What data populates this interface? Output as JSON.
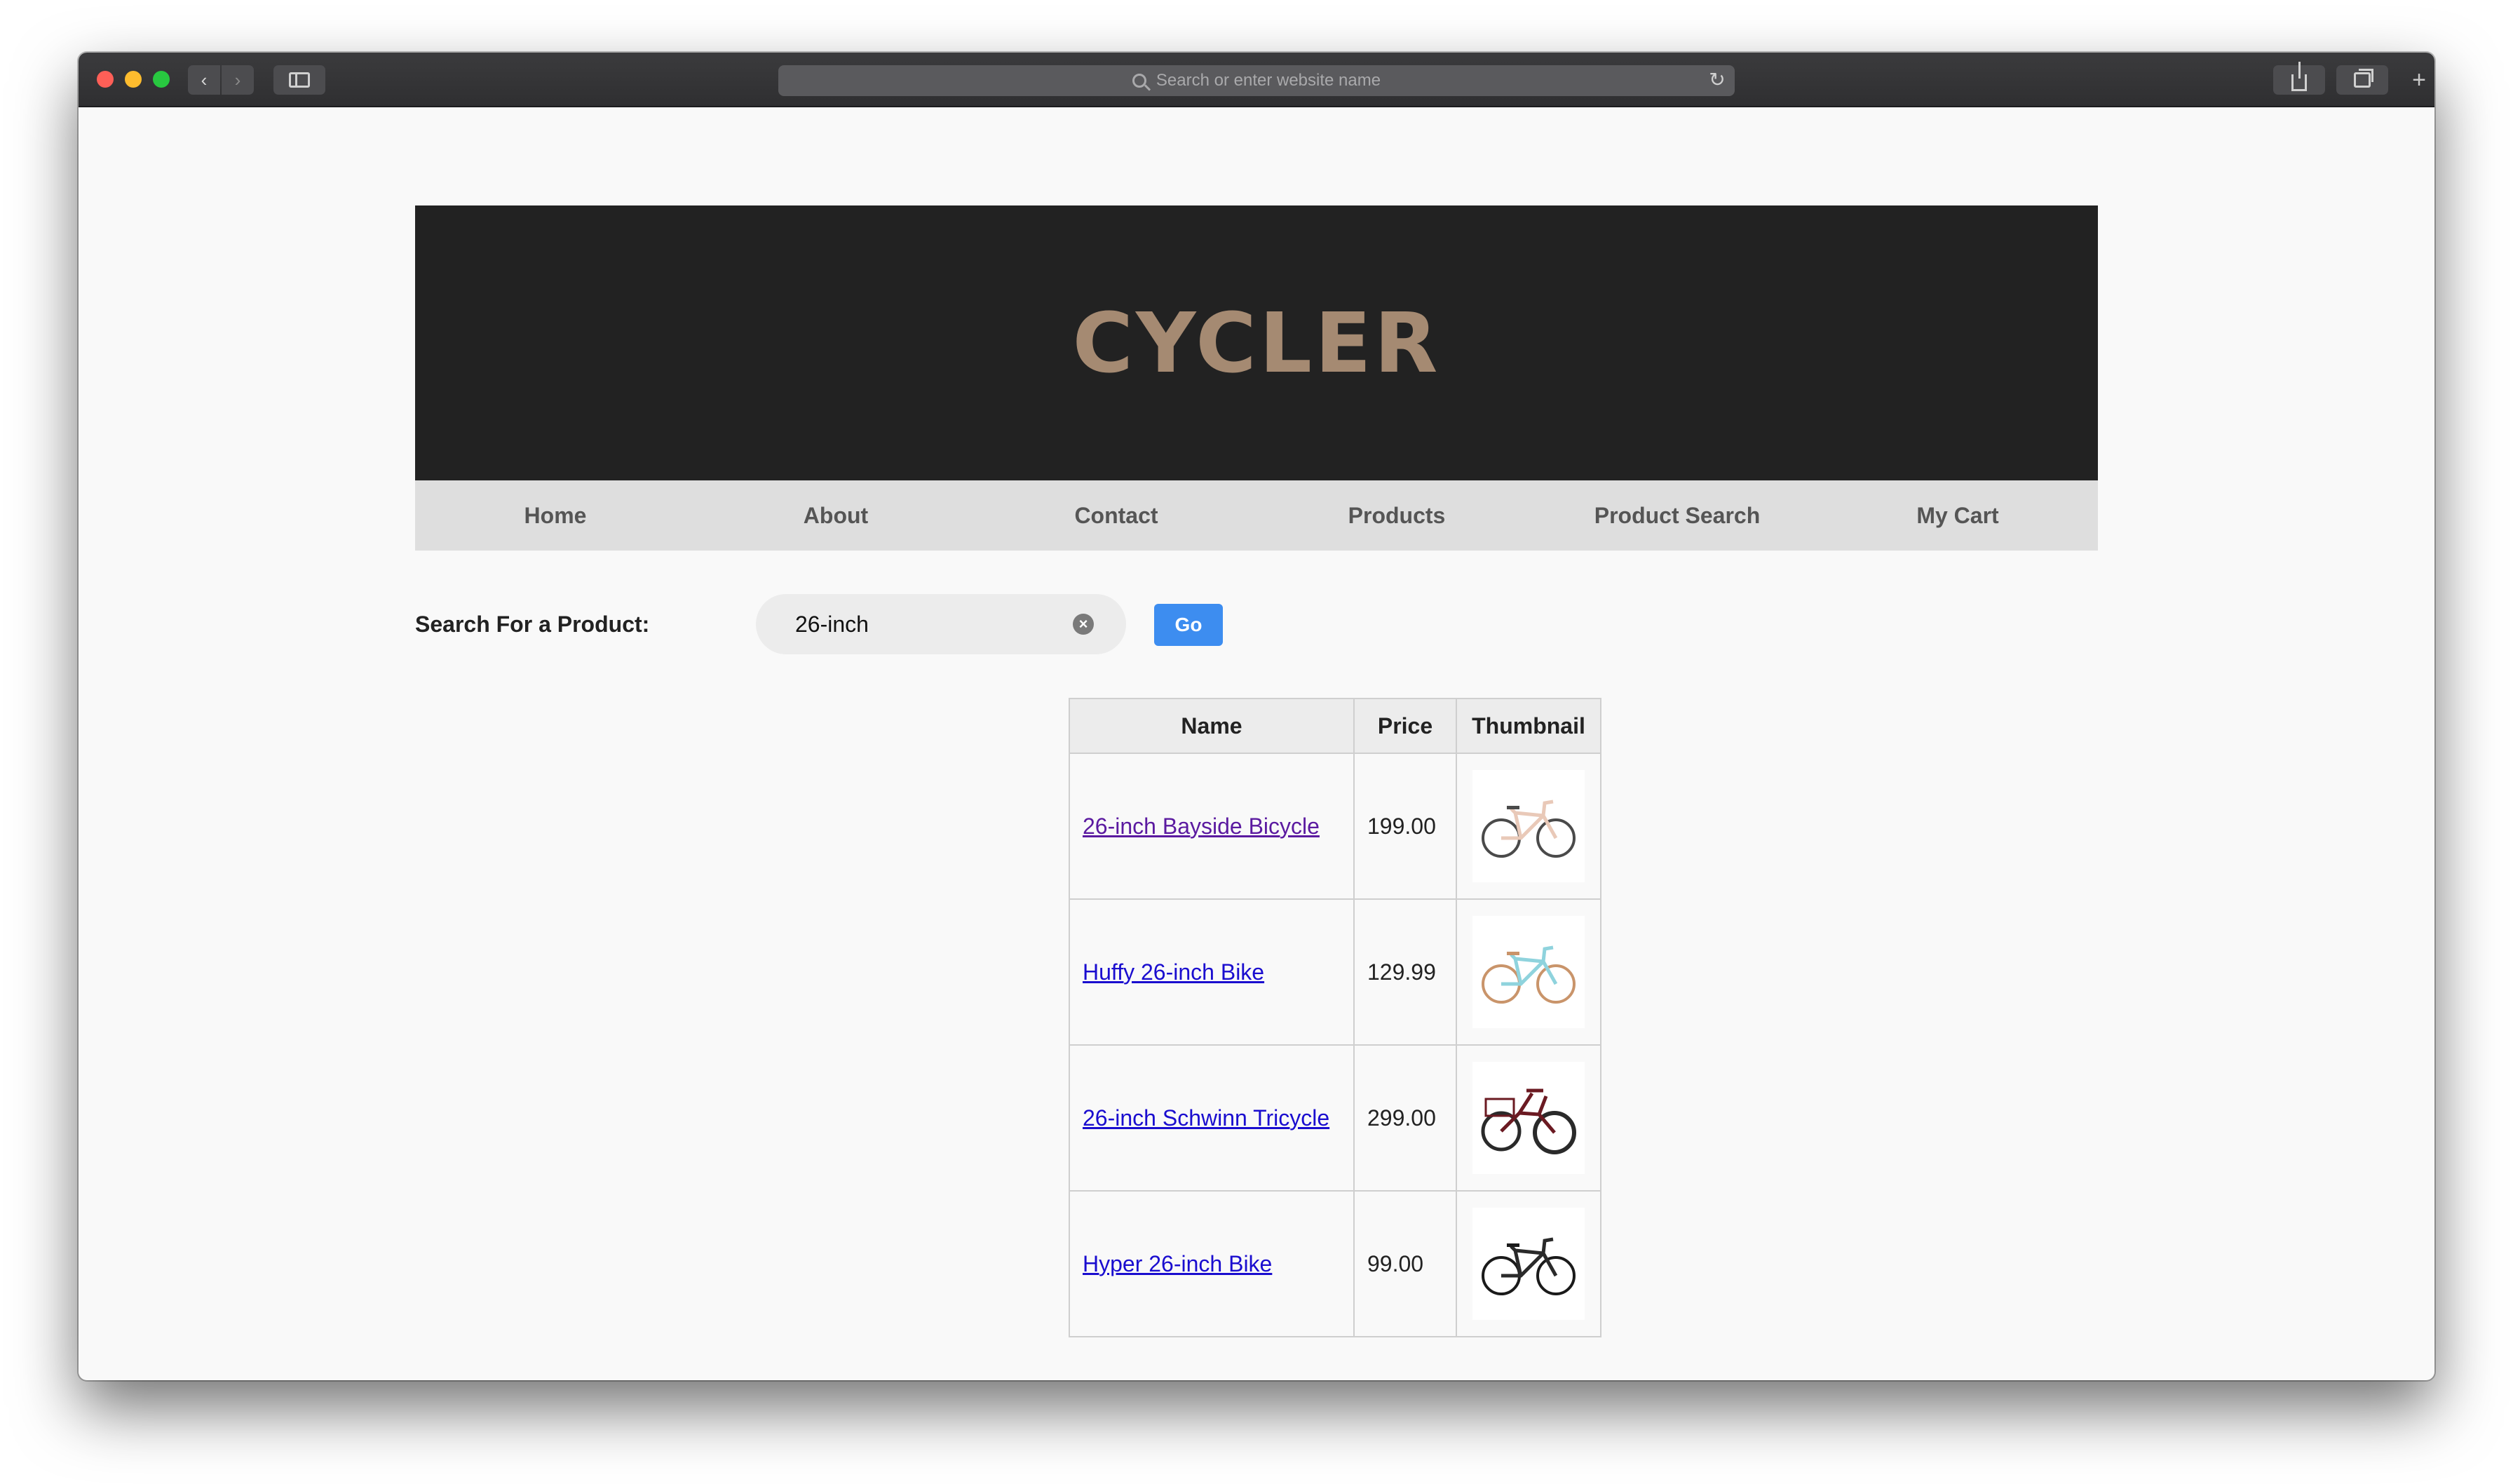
{
  "browser": {
    "address_placeholder": "Search or enter website name"
  },
  "site": {
    "brand": "CYCLER",
    "nav": [
      {
        "label": "Home"
      },
      {
        "label": "About"
      },
      {
        "label": "Contact"
      },
      {
        "label": "Products"
      },
      {
        "label": "Product Search"
      },
      {
        "label": "My Cart"
      }
    ]
  },
  "search": {
    "label": "Search For a Product:",
    "value": "26-inch",
    "go_label": "Go"
  },
  "table": {
    "headers": [
      "Name",
      "Price",
      "Thumbnail"
    ],
    "rows": [
      {
        "name": "26-inch Bayside Bicycle",
        "price": "199.00",
        "frame_color": "#e9c9b8",
        "wheel_color": "#4a4a4a",
        "visited": true
      },
      {
        "name": "Huffy 26-inch Bike",
        "price": "129.99",
        "frame_color": "#8fd3dd",
        "wheel_color": "#c9946a",
        "visited": false
      },
      {
        "name": "26-inch Schwinn Tricycle",
        "price": "299.00",
        "frame_color": "#6b1a22",
        "wheel_color": "#2a2a2a",
        "visited": false
      },
      {
        "name": "Hyper 26-inch Bike",
        "price": "99.00",
        "frame_color": "#2a2a2a",
        "wheel_color": "#1a1a1a",
        "visited": false
      }
    ]
  }
}
